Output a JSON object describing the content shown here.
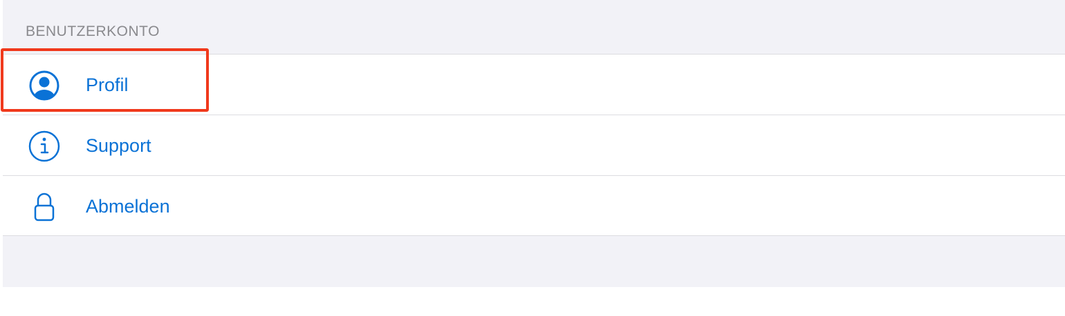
{
  "section": {
    "header": "BENUTZERKONTO"
  },
  "menu": {
    "items": [
      {
        "label": "Profil",
        "icon": "person-circle-icon",
        "highlighted": true
      },
      {
        "label": "Support",
        "icon": "info-circle-icon",
        "highlighted": false
      },
      {
        "label": "Abmelden",
        "icon": "lock-icon",
        "highlighted": false
      }
    ]
  },
  "colors": {
    "accent": "#0a72d6",
    "grouped_background": "#f2f2f7",
    "section_header_text": "#8a8a8e",
    "highlight_border": "#f0391c"
  }
}
